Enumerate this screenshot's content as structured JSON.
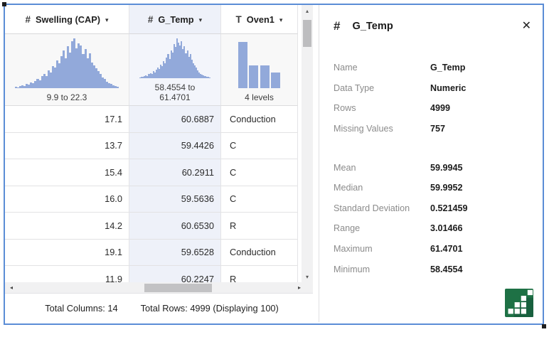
{
  "colors": {
    "accent_border": "#5b8dd6",
    "bar_fill": "#92a9da",
    "selected_column_bg": "#eef1f9",
    "selected_summary_bg": "#f3f5fb",
    "summary_bg": "#f8f8f8",
    "stats_icon_green": "#1e7145",
    "stats_icon_green_shadow": "#145238"
  },
  "icons": {
    "caret": "▾",
    "scroll_up": "▴",
    "scroll_down": "▾",
    "scroll_left": "◂",
    "scroll_right": "▸"
  },
  "table": {
    "columns": [
      {
        "type_icon": "#",
        "name": "Swelling (CAP)",
        "summary_label": "9.9 to 22.3",
        "selected": false
      },
      {
        "type_icon": "#",
        "name": "G_Temp",
        "summary_label": "58.4554 to 61.4701",
        "selected": true
      },
      {
        "type_icon": "T",
        "name": "Oven1",
        "summary_label": "4 levels",
        "selected": false
      }
    ],
    "histograms": {
      "swelling": [
        3,
        2,
        4,
        6,
        5,
        9,
        7,
        12,
        10,
        15,
        19,
        16,
        24,
        28,
        25,
        36,
        32,
        45,
        41,
        56,
        50,
        64,
        76,
        60,
        84,
        72,
        95,
        100,
        80,
        90,
        86,
        68,
        78,
        60,
        70,
        52,
        46,
        40,
        34,
        28,
        22,
        18,
        13,
        10,
        8,
        6,
        4,
        3
      ],
      "g_temp": [
        2,
        3,
        4,
        6,
        8,
        6,
        10,
        13,
        11,
        17,
        15,
        22,
        27,
        24,
        34,
        30,
        42,
        38,
        52,
        60,
        48,
        70,
        64,
        86,
        78,
        100,
        90,
        82,
        92,
        74,
        80,
        62,
        70,
        54,
        60,
        46,
        38,
        32,
        26,
        20,
        15,
        11,
        9,
        7,
        5,
        4,
        3,
        2
      ],
      "oven1": [
        93,
        46,
        46,
        31
      ]
    },
    "rows": [
      {
        "swelling": "17.1",
        "g_temp": "60.6887",
        "oven1": "Conduction"
      },
      {
        "swelling": "13.7",
        "g_temp": "59.4426",
        "oven1": "C"
      },
      {
        "swelling": "15.4",
        "g_temp": "60.2911",
        "oven1": "C"
      },
      {
        "swelling": "16.0",
        "g_temp": "59.5636",
        "oven1": "C"
      },
      {
        "swelling": "14.2",
        "g_temp": "60.6530",
        "oven1": "R"
      },
      {
        "swelling": "19.1",
        "g_temp": "59.6528",
        "oven1": "Conduction"
      },
      {
        "swelling": "11.9",
        "g_temp": "60.2247",
        "oven1": "R"
      }
    ],
    "footer": {
      "total_columns": "Total Columns: 14",
      "total_rows": "Total Rows: 4999 (Displaying 100)"
    }
  },
  "panel": {
    "type_icon": "#",
    "title": "G_Temp",
    "close_icon": "✕",
    "fields": [
      {
        "label": "Name",
        "value": "G_Temp",
        "gap_before": false
      },
      {
        "label": "Data Type",
        "value": "Numeric",
        "gap_before": false
      },
      {
        "label": "Rows",
        "value": "4999",
        "gap_before": false
      },
      {
        "label": "Missing Values",
        "value": "757",
        "gap_before": false
      },
      {
        "label": "Mean",
        "value": "59.9945",
        "gap_before": true
      },
      {
        "label": "Median",
        "value": "59.9952",
        "gap_before": false
      },
      {
        "label": "Standard Deviation",
        "value": "0.521459",
        "gap_before": false
      },
      {
        "label": "Range",
        "value": "3.01466",
        "gap_before": false
      },
      {
        "label": "Maximum",
        "value": "61.4701",
        "gap_before": false
      },
      {
        "label": "Minimum",
        "value": "58.4554",
        "gap_before": false
      }
    ]
  }
}
